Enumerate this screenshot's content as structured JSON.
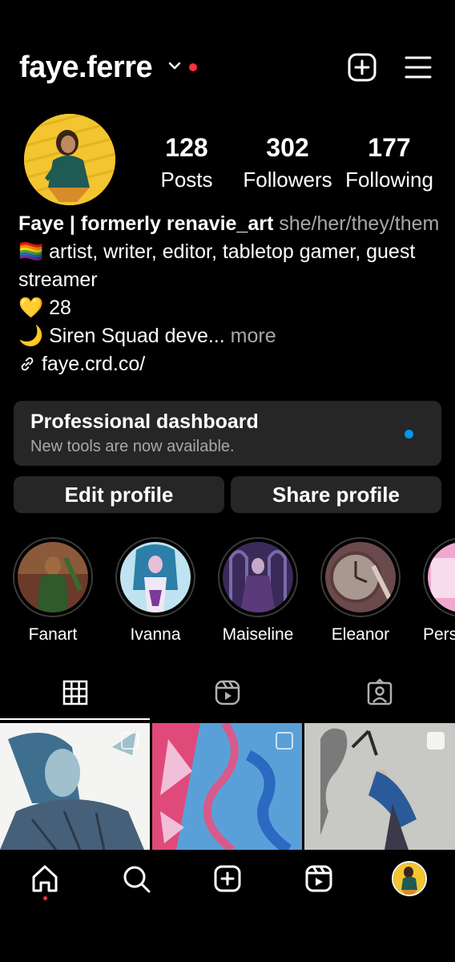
{
  "header": {
    "username": "faye.ferre",
    "icons": [
      "chevron-down-icon",
      "new-post-icon",
      "menu-icon"
    ]
  },
  "stats": [
    {
      "value": "128",
      "label": "Posts"
    },
    {
      "value": "302",
      "label": "Followers"
    },
    {
      "value": "177",
      "label": "Following"
    }
  ],
  "bio": {
    "name": "Faye | formerly renavie_art",
    "pronouns": "she/her/they/them",
    "line1_emoji": "🏳️‍🌈",
    "line1": "artist, writer, editor, tabletop gamer, guest",
    "line2": "streamer",
    "line3_emoji": "💛",
    "line3": "28",
    "line4_emoji": "🌙",
    "line4": "Siren Squad deve...",
    "more": "more",
    "link": "faye.crd.co/"
  },
  "dashboard": {
    "title": "Professional dashboard",
    "subtitle": "New tools are now available."
  },
  "buttons": {
    "edit": "Edit profile",
    "share": "Share profile"
  },
  "highlights": [
    {
      "label": "Fanart"
    },
    {
      "label": "Ivanna"
    },
    {
      "label": "Maiseline"
    },
    {
      "label": "Eleanor"
    },
    {
      "label": "Perse"
    }
  ],
  "tabs": [
    "grid-icon",
    "reels-icon",
    "tagged-icon"
  ],
  "nav": [
    "home-icon",
    "search-icon",
    "create-icon",
    "reels-icon",
    "profile-avatar"
  ],
  "colors": {
    "background": "#000000",
    "surface": "#262626",
    "accent_blue": "#0095f6",
    "notification_red": "#ff3040",
    "secondary_text": "#a8a8a8"
  }
}
